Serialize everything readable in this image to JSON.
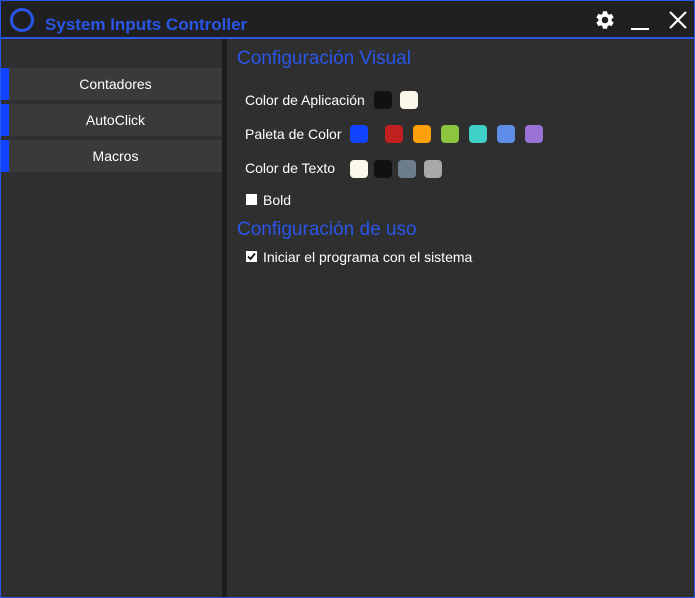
{
  "window": {
    "title": "System Inputs Controller",
    "accent_color": "#2a56e8",
    "controls": {
      "settings_icon": "gear-icon",
      "minimize_icon": "minimize-icon",
      "close_icon": "close-icon"
    }
  },
  "sidebar": {
    "items": [
      {
        "label": "Contadores"
      },
      {
        "label": "AutoClick"
      },
      {
        "label": "Macros"
      }
    ]
  },
  "settings": {
    "visual": {
      "title": "Configuración Visual",
      "app_color": {
        "label": "Color de Aplicación",
        "swatches": [
          "#111111",
          "#fbf7ea"
        ]
      },
      "palette": {
        "label": "Paleta de Color",
        "selected": "#1144ff",
        "swatches": [
          "#c0211f",
          "#ff9f0a",
          "#8cc63f",
          "#3fd1c7",
          "#5f8ee8",
          "#9b72d6"
        ]
      },
      "text_color": {
        "label": "Color de Texto",
        "swatches": [
          "#fbf7ea",
          "#111111",
          "#6d7d8b",
          "#a8a8a8"
        ]
      },
      "bold": {
        "label": "Bold",
        "checked": false
      }
    },
    "usage": {
      "title": "Configuración de uso",
      "startup": {
        "label": "Iniciar el programa con el sistema",
        "checked": true
      }
    }
  }
}
